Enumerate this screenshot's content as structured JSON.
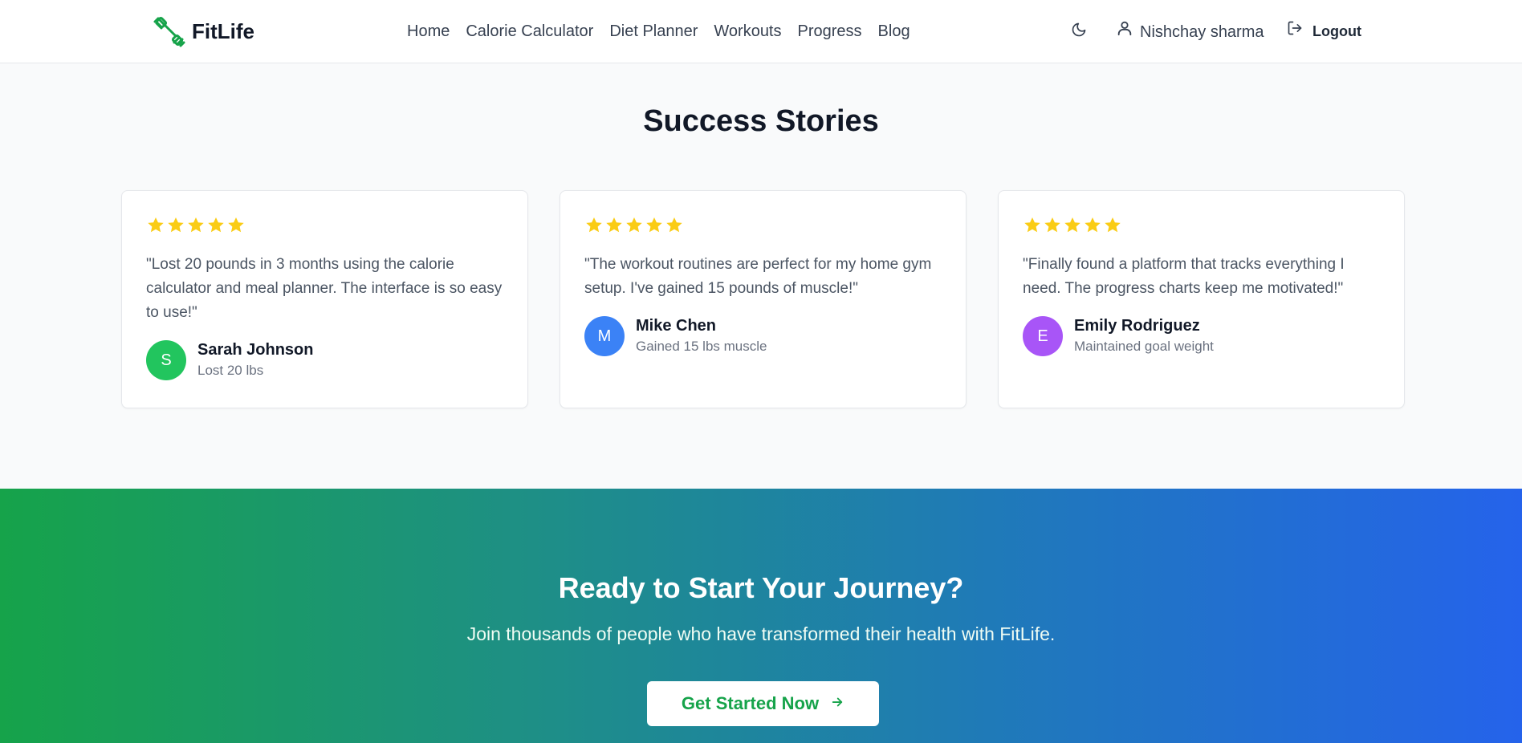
{
  "header": {
    "brand": "FitLife",
    "nav": [
      "Home",
      "Calorie Calculator",
      "Diet Planner",
      "Workouts",
      "Progress",
      "Blog"
    ],
    "user_name": "Nishchay sharma",
    "logout_label": "Logout"
  },
  "stories": {
    "title": "Success Stories",
    "items": [
      {
        "rating": 5,
        "quote": "\"Lost 20 pounds in 3 months using the calorie calculator and meal planner. The interface is so easy to use!\"",
        "initial": "S",
        "name": "Sarah Johnson",
        "result": "Lost 20 lbs",
        "avatar_color": "#22c55e"
      },
      {
        "rating": 5,
        "quote": "\"The workout routines are perfect for my home gym setup. I've gained 15 pounds of muscle!\"",
        "initial": "M",
        "name": "Mike Chen",
        "result": "Gained 15 lbs muscle",
        "avatar_color": "#3b82f6"
      },
      {
        "rating": 5,
        "quote": "\"Finally found a platform that tracks everything I need. The progress charts keep me motivated!\"",
        "initial": "E",
        "name": "Emily Rodriguez",
        "result": "Maintained goal weight",
        "avatar_color": "#a855f7"
      }
    ]
  },
  "cta": {
    "title": "Ready to Start Your Journey?",
    "subtitle": "Join thousands of people who have transformed their health with FitLife.",
    "button_label": "Get Started Now"
  },
  "colors": {
    "brand_green": "#16a34a",
    "star": "#facc15",
    "gradient_start": "#16a34a",
    "gradient_end": "#2563eb"
  },
  "icons": [
    "dumbbell-icon",
    "moon-icon",
    "user-icon",
    "logout-icon",
    "star-icon",
    "arrow-right-icon"
  ]
}
